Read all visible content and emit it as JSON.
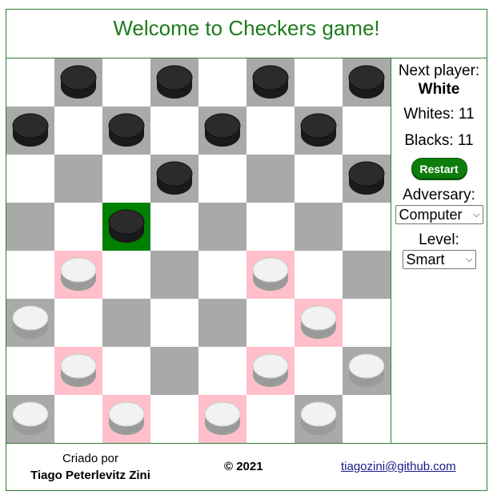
{
  "header": {
    "title": "Welcome to Checkers game!"
  },
  "colors": {
    "accent_green": "#1e7a1e",
    "dark_square": "#a9a9a9",
    "light_square": "#ffffff",
    "hint_square": "#ffc0cb",
    "selected_square": "#008000",
    "black_piece": "#2b2b2b",
    "white_piece": "#f2f2f2"
  },
  "board": {
    "squares": [
      [
        "light",
        "dark",
        "light",
        "dark",
        "light",
        "dark",
        "light",
        "dark"
      ],
      [
        "dark",
        "light",
        "dark",
        "light",
        "dark",
        "light",
        "dark",
        "light"
      ],
      [
        "light",
        "dark",
        "light",
        "dark",
        "light",
        "dark",
        "light",
        "dark"
      ],
      [
        "dark",
        "light",
        "selected",
        "light",
        "dark",
        "light",
        "dark",
        "light"
      ],
      [
        "light",
        "hint",
        "light",
        "dark",
        "light",
        "hint",
        "light",
        "dark"
      ],
      [
        "dark",
        "light",
        "dark",
        "light",
        "dark",
        "light",
        "hint",
        "light"
      ],
      [
        "light",
        "hint",
        "light",
        "dark",
        "light",
        "hint",
        "light",
        "dark"
      ],
      [
        "dark",
        "light",
        "hint",
        "light",
        "hint",
        "light",
        "dark",
        "light"
      ]
    ],
    "pieces": [
      [
        null,
        "black",
        null,
        "black",
        null,
        "black",
        null,
        "black"
      ],
      [
        "black",
        null,
        "black",
        null,
        "black",
        null,
        "black",
        null
      ],
      [
        null,
        null,
        null,
        "black",
        null,
        null,
        null,
        "black"
      ],
      [
        null,
        null,
        "black",
        null,
        null,
        null,
        null,
        null
      ],
      [
        null,
        "white",
        null,
        null,
        null,
        "white",
        null,
        null
      ],
      [
        "white",
        null,
        null,
        null,
        null,
        null,
        "white",
        null
      ],
      [
        null,
        "white",
        null,
        null,
        null,
        "white",
        null,
        "white"
      ],
      [
        "white",
        null,
        "white",
        null,
        "white",
        null,
        "white",
        null
      ]
    ]
  },
  "sidebar": {
    "next_player_label": "Next player:",
    "next_player_value": "White",
    "whites_label": "Whites: 11",
    "blacks_label": "Blacks: 11",
    "restart_label": "Restart",
    "adversary_label": "Adversary:",
    "adversary_value": "Computer",
    "level_label": "Level:",
    "level_value": "Smart"
  },
  "footer": {
    "created_by": "Criado por",
    "author": "Tiago Peterlevitz Zini",
    "copyright": "© 2021",
    "link": "tiagozini@github.com"
  }
}
